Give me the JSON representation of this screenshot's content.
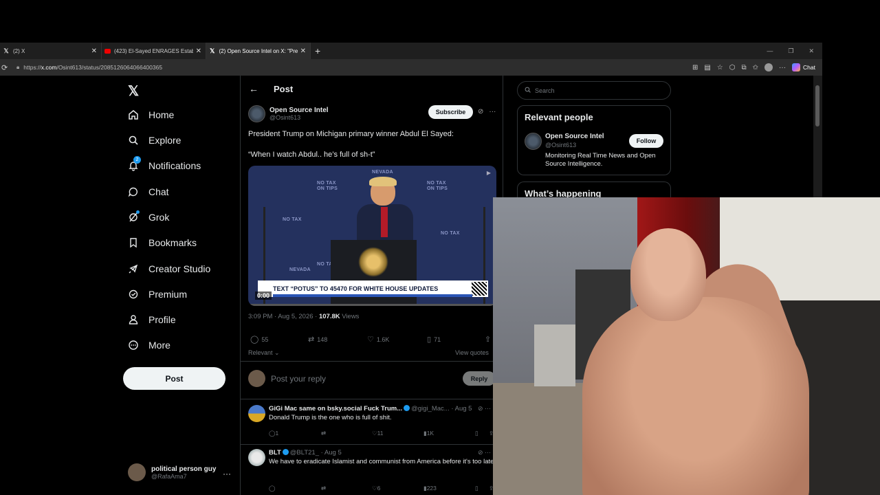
{
  "browser": {
    "tabs": [
      {
        "label": "(2) X",
        "favicon": "X",
        "active": false
      },
      {
        "label": "(423) El-Sayed ENRAGES Establish",
        "favicon": "yt",
        "active": false
      },
      {
        "label": "(2) Open Source Intel on X: \"Presi",
        "favicon": "X",
        "active": true
      }
    ],
    "url_prefix": "https://",
    "url_domain": "x.com",
    "url_path": "/Osint613/status/2085126064066400365",
    "chat_label": "Chat"
  },
  "nav": {
    "items": [
      {
        "label": "Home",
        "icon": "home-icon"
      },
      {
        "label": "Explore",
        "icon": "search-icon"
      },
      {
        "label": "Notifications",
        "icon": "bell-icon",
        "badge": "2"
      },
      {
        "label": "Chat",
        "icon": "chat-icon"
      },
      {
        "label": "Grok",
        "icon": "grok-icon"
      },
      {
        "label": "Bookmarks",
        "icon": "bookmark-icon"
      },
      {
        "label": "Creator Studio",
        "icon": "rocket-icon"
      },
      {
        "label": "Premium",
        "icon": "verified-icon"
      },
      {
        "label": "Profile",
        "icon": "person-icon"
      },
      {
        "label": "More",
        "icon": "more-circle-icon"
      }
    ],
    "post_label": "Post",
    "user_name": "political person guy",
    "user_handle": "@RafaAma7"
  },
  "post": {
    "header_title": "Post",
    "author_name": "Open Source Intel",
    "author_handle": "@Osint613",
    "subscribe_label": "Subscribe",
    "text_line1": "President Trump on Michigan primary winner Abdul El Sayed:",
    "text_line2": "“When I watch Abdul.. he’s full of sh-t”",
    "video_banner": "TEXT “POTUS” TO 45470 FOR WHITE HOUSE UPDATES",
    "video_time": "0:00",
    "timestamp": "3:09 PM · Aug 5, 2026 · ",
    "views_count": "107.8K",
    "views_label": " Views",
    "replies": "55",
    "reposts": "148",
    "likes": "1.6K",
    "bookmarks": "71",
    "sort_label": "Relevant",
    "view_quotes": "View quotes"
  },
  "reply_box": {
    "placeholder": "Post your reply",
    "button_label": "Reply"
  },
  "replies": [
    {
      "name": "GiGi Mac same on bsky.social Fuck Trum...",
      "handle": "@gigi_Mac...",
      "date": " · Aug 5",
      "text": "Donald Trump is the one who is full of shit.",
      "replies": "1",
      "likes": "11",
      "views": "1K"
    },
    {
      "name": "BLT",
      "handle": "@BLT21_",
      "date": " · Aug 5",
      "text": "We have to eradicate Islamist and communist from America before it's too late",
      "replies": "",
      "likes": "6",
      "views": "223"
    }
  ],
  "sidebar": {
    "search_placeholder": "Search",
    "relevant_title": "Relevant people",
    "person_name": "Open Source Intel",
    "person_handle": "@Osint613",
    "follow_label": "Follow",
    "person_bio": "Monitoring Real Time News and Open Source Intelligence.",
    "happening_title": "What’s happening"
  },
  "colors": {
    "accent": "#1d9bf0",
    "background": "#000000",
    "border": "#2f3336",
    "muted_text": "#71767b"
  }
}
